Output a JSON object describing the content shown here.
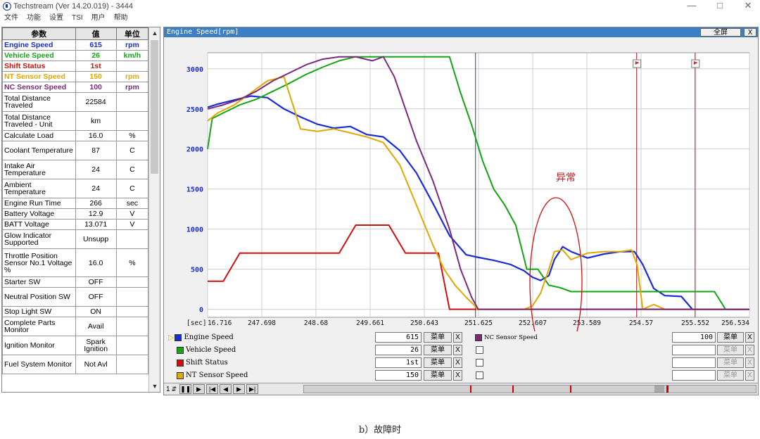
{
  "window": {
    "title": "Techstream (Ver 14.20.019) - 3444"
  },
  "menu": [
    "文件",
    "功能",
    "设置",
    "TSI",
    "用户",
    "帮助"
  ],
  "table": {
    "headers": [
      "参数",
      "值",
      "单位"
    ],
    "rows": [
      {
        "name": "Engine Speed",
        "value": "615",
        "unit": "rpm",
        "color": "#1b2bd6"
      },
      {
        "name": "Vehicle Speed",
        "value": "26",
        "unit": "km/h",
        "color": "#13a513"
      },
      {
        "name": "Shift Status",
        "value": "1st",
        "unit": "",
        "color": "#d01010"
      },
      {
        "name": "NT Sensor Speed",
        "value": "150",
        "unit": "rpm",
        "color": "#e0a800"
      },
      {
        "name": "NC Sensor Speed",
        "value": "100",
        "unit": "rpm",
        "color": "#7a2a7a"
      },
      {
        "name": "Total Distance Traveled",
        "value": "22584",
        "unit": ""
      },
      {
        "name": "Total Distance Traveled - Unit",
        "value": "km",
        "unit": ""
      },
      {
        "name": "Calculate Load",
        "value": "16.0",
        "unit": "%"
      },
      {
        "name": "Coolant Temperature",
        "value": "87",
        "unit": "C"
      },
      {
        "name": "Intake Air Temperature",
        "value": "24",
        "unit": "C"
      },
      {
        "name": "Ambient Temperature",
        "value": "24",
        "unit": "C"
      },
      {
        "name": "Engine Run Time",
        "value": "266",
        "unit": "sec"
      },
      {
        "name": "Battery Voltage",
        "value": "12.9",
        "unit": "V"
      },
      {
        "name": "BATT Voltage",
        "value": "13.071",
        "unit": "V"
      },
      {
        "name": "Glow Indicator Supported",
        "value": "Unsupp",
        "unit": ""
      },
      {
        "name": "Throttle Position Sensor No.1 Voltage %",
        "value": "16.0",
        "unit": "%"
      },
      {
        "name": "Starter SW",
        "value": "OFF",
        "unit": ""
      },
      {
        "name": "Neutral Position SW",
        "value": "OFF",
        "unit": ""
      },
      {
        "name": "Stop Light SW",
        "value": "ON",
        "unit": ""
      },
      {
        "name": "Complete Parts Monitor",
        "value": "Avail",
        "unit": ""
      },
      {
        "name": "Ignition Monitor",
        "value": "Spark Ignition",
        "unit": ""
      },
      {
        "name": "Fuel System Monitor",
        "value": "Not Avl",
        "unit": ""
      }
    ]
  },
  "graph": {
    "header": "Engine Speed[rpm]",
    "fullscreen_label": "全屏",
    "close_label": "X",
    "annotation": "异常",
    "menu_label": "菜单",
    "x_label": "X",
    "legend": [
      {
        "name": "Engine Speed",
        "value": "615",
        "color": "#1b2bd6"
      },
      {
        "name": "Vehicle Speed",
        "value": "26",
        "color": "#13a513"
      },
      {
        "name": "Shift Status",
        "value": "1st",
        "color": "#d01010"
      },
      {
        "name": "NT Sensor Speed",
        "value": "150",
        "color": "#e0a800"
      }
    ],
    "legend2": {
      "name": "NC Sensor Speed",
      "value": "100",
      "color": "#7a2a7a"
    },
    "page_number": "1"
  },
  "chart_data": {
    "type": "line",
    "title": "Engine Speed[rpm]",
    "xlabel": "[sec]",
    "x_ticks": [
      "16.716",
      "247.698",
      "248.68",
      "249.661",
      "250.643",
      "251.625",
      "252.607",
      "253.589",
      "254.57",
      "255.552",
      "256.534"
    ],
    "y_ticks": [
      0,
      500,
      1000,
      1500,
      2000,
      2500,
      3000
    ],
    "xlim": [
      246.716,
      256.534
    ],
    "ylim": [
      -100,
      3200
    ],
    "grid": true,
    "series": [
      {
        "name": "Engine Speed",
        "color": "#1b2bd6",
        "x": [
          246.716,
          246.9,
          247.2,
          247.5,
          247.8,
          248.1,
          248.4,
          248.7,
          249.0,
          249.3,
          249.6,
          249.9,
          250.2,
          250.5,
          250.8,
          251.1,
          251.4,
          251.6,
          251.9,
          252.2,
          252.45,
          252.6,
          252.75,
          252.9,
          253.0,
          253.15,
          253.3,
          253.6,
          253.9,
          254.2,
          254.45,
          254.6,
          254.8,
          255.0,
          255.3,
          255.5,
          255.8,
          256.1,
          256.534
        ],
        "y": [
          2520,
          2560,
          2610,
          2660,
          2640,
          2500,
          2400,
          2310,
          2260,
          2280,
          2180,
          2150,
          1980,
          1700,
          1320,
          920,
          680,
          650,
          610,
          560,
          480,
          400,
          360,
          420,
          620,
          780,
          720,
          640,
          690,
          720,
          720,
          560,
          260,
          170,
          160,
          0,
          0,
          0,
          0
        ]
      },
      {
        "name": "Vehicle Speed",
        "color": "#13a513",
        "x": [
          246.716,
          246.8,
          247.0,
          247.3,
          247.6,
          247.9,
          248.2,
          248.5,
          248.8,
          249.1,
          249.4,
          249.7,
          250.0,
          250.3,
          250.6,
          250.9,
          251.1,
          251.3,
          251.5,
          251.7,
          251.9,
          252.1,
          252.3,
          252.5,
          252.7,
          252.9,
          253.1,
          253.3,
          253.6,
          254.0,
          254.4,
          254.8,
          255.2,
          255.6,
          255.9,
          256.1,
          256.534
        ],
        "y": [
          2000,
          2380,
          2450,
          2550,
          2620,
          2720,
          2820,
          2930,
          3020,
          3100,
          3150,
          3150,
          3150,
          3150,
          3150,
          3150,
          3150,
          2700,
          2300,
          1850,
          1500,
          1300,
          1050,
          500,
          500,
          300,
          270,
          220,
          220,
          220,
          220,
          220,
          220,
          220,
          220,
          0,
          0
        ]
      },
      {
        "name": "Shift Status",
        "color": "#d01010",
        "x": [
          246.716,
          247.0,
          247.3,
          247.6,
          247.9,
          248.2,
          248.5,
          248.8,
          249.1,
          249.4,
          249.7,
          250.0,
          250.3,
          250.6,
          250.9,
          251.1,
          251.3,
          251.6,
          251.9,
          252.2,
          252.5,
          252.8,
          253.1,
          253.4,
          253.7,
          254.0,
          254.3,
          254.6,
          254.9,
          255.2,
          255.5,
          255.8,
          256.1,
          256.534
        ],
        "y": [
          350,
          350,
          700,
          700,
          700,
          700,
          700,
          700,
          700,
          1050,
          1050,
          1050,
          700,
          700,
          700,
          0,
          0,
          0,
          0,
          0,
          0,
          0,
          0,
          0,
          0,
          0,
          0,
          0,
          0,
          0,
          0,
          0,
          0,
          0
        ]
      },
      {
        "name": "NT Sensor Speed",
        "color": "#e0a800",
        "x": [
          246.716,
          246.9,
          247.2,
          247.5,
          247.8,
          248.1,
          248.4,
          248.7,
          249.0,
          249.3,
          249.6,
          249.9,
          250.2,
          250.5,
          250.8,
          251.0,
          251.2,
          251.4,
          251.55,
          251.6,
          252.2,
          252.45,
          252.6,
          252.75,
          252.9,
          253.0,
          253.15,
          253.3,
          253.6,
          253.9,
          254.2,
          254.4,
          254.5,
          254.6,
          254.8,
          255.0,
          256.534
        ],
        "y": [
          2350,
          2450,
          2550,
          2700,
          2850,
          2900,
          2250,
          2220,
          2250,
          2200,
          2150,
          2080,
          1800,
          1300,
          800,
          500,
          300,
          150,
          50,
          0,
          0,
          0,
          40,
          200,
          500,
          720,
          740,
          620,
          700,
          720,
          720,
          740,
          550,
          0,
          60,
          0,
          0
        ]
      },
      {
        "name": "NC Sensor Speed",
        "color": "#7a2a7a",
        "x": [
          246.716,
          247.0,
          247.3,
          247.6,
          247.9,
          248.2,
          248.5,
          248.8,
          249.1,
          249.4,
          249.7,
          249.9,
          250.1,
          250.3,
          250.5,
          250.8,
          251.1,
          251.3,
          251.5,
          251.62,
          251.7,
          252.5,
          253.5,
          254.5,
          255.5,
          256.534
        ],
        "y": [
          2500,
          2550,
          2620,
          2720,
          2850,
          2950,
          3050,
          3120,
          3150,
          3150,
          3100,
          3150,
          2900,
          2500,
          2100,
          1600,
          1000,
          500,
          150,
          0,
          0,
          0,
          0,
          0,
          0,
          0
        ]
      }
    ]
  },
  "caption": "b）故障时"
}
